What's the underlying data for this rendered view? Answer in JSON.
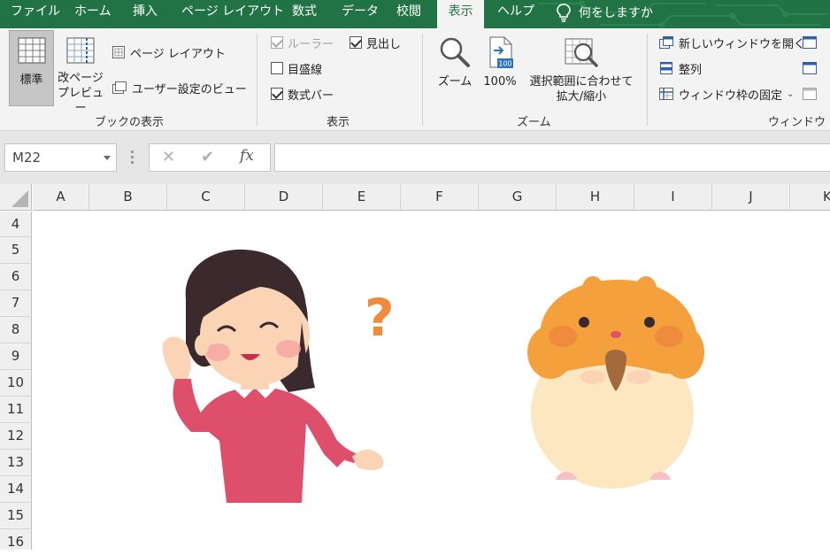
{
  "ribbon_tabs": [
    "ファイル",
    "ホーム",
    "挿入",
    "ページ レイアウト",
    "数式",
    "データ",
    "校閲",
    "表示",
    "ヘルプ"
  ],
  "active_tab": "表示",
  "tell_me": "何をしますか",
  "groups": {
    "workbook_views": {
      "label": "ブックの表示",
      "normal": "標準",
      "page_break_1": "改ページ",
      "page_break_2": "プレビュー",
      "page_layout": "ページ レイアウト",
      "custom_views": "ユーザー設定のビュー"
    },
    "show": {
      "label": "表示",
      "ruler": "ルーラー",
      "gridlines": "目盛線",
      "formula_bar": "数式バー",
      "headings": "見出し",
      "ruler_checked": true,
      "ruler_disabled": true,
      "gridlines_checked": false,
      "formula_bar_checked": true,
      "headings_checked": true
    },
    "zoom": {
      "label": "ズーム",
      "zoom": "ズーム",
      "zoom_100": "100%",
      "zoom_100_badge": "100",
      "zoom_selection_1": "選択範囲に合わせて",
      "zoom_selection_2": "拡大/縮小"
    },
    "window": {
      "label": "ウィンドウ",
      "new_window": "新しいウィンドウを開く",
      "arrange_all": "整列",
      "freeze_panes": "ウィンドウ枠の固定"
    }
  },
  "formula_bar": {
    "name_box": "M22",
    "cancel": "✕",
    "enter": "✔",
    "fx": "fx",
    "formula": ""
  },
  "columns": [
    "A",
    "B",
    "C",
    "D",
    "E",
    "F",
    "G",
    "H",
    "I",
    "J",
    "K"
  ],
  "rows": [
    "4",
    "5",
    "6",
    "7",
    "8",
    "9",
    "10",
    "11",
    "12",
    "13",
    "14",
    "15",
    "16"
  ],
  "images": {
    "question_mark": "?"
  },
  "colors": {
    "excel_green": "#217346",
    "ribbon_bg": "#f3f3f3",
    "header_bg": "#efefef"
  }
}
